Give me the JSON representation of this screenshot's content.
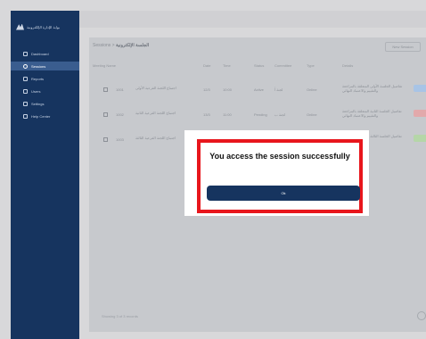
{
  "brand": {
    "name": "بوابة الإدارة الإلكترونية"
  },
  "sidebar": {
    "items": [
      {
        "label": "Dashboard",
        "active": false
      },
      {
        "label": "Sessions",
        "active": true
      },
      {
        "label": "Reports",
        "active": false
      },
      {
        "label": "Users",
        "active": false
      },
      {
        "label": "Settings",
        "active": false
      },
      {
        "label": "Help Center",
        "active": false
      }
    ]
  },
  "header": {
    "breadcrumb": "Sessions >",
    "title": "الجلسة الإلكترونية",
    "action_button": "New Session"
  },
  "table": {
    "columns": [
      "Meeting Name",
      "Date",
      "Time",
      "Status",
      "Committee",
      "Type",
      "Details"
    ],
    "rows": [
      {
        "id": "1001",
        "name": "اجتماع اللجنة الفرعية الأولى",
        "date": "12/3",
        "time": "10:00",
        "status": "Active",
        "committee": "لجنة أ",
        "type": "Online",
        "details": "تفاصيل الجلسة الأولى المتعلقة بالمراجعة والتقييم والاعتماد النهائي",
        "badge_color": "#a8c4e6"
      },
      {
        "id": "1002",
        "name": "اجتماع اللجنة الفرعية الثانية",
        "date": "13/3",
        "time": "11:00",
        "status": "Pending",
        "committee": "لجنة ب",
        "type": "Online",
        "details": "تفاصيل الجلسة الثانية المتعلقة بالمراجعة والتقييم والاعتماد النهائي",
        "badge_color": "#e2a9ab"
      },
      {
        "id": "1003",
        "name": "اجتماع اللجنة الفرعية الثالثة",
        "date": "14/3",
        "time": "12:00",
        "status": "Done",
        "committee": "لجنة ج",
        "type": "Online",
        "details": "تفاصيل الجلسة الثالثة المتعلقة بالمراجعة",
        "badge_color": "#b5d6a8"
      }
    ]
  },
  "footer": {
    "text": "Showing 3 of 3 records"
  },
  "modal": {
    "message": "You access the session successfully",
    "button_label": "Ok",
    "border_color": "#e8161c",
    "button_color": "#16345f"
  }
}
